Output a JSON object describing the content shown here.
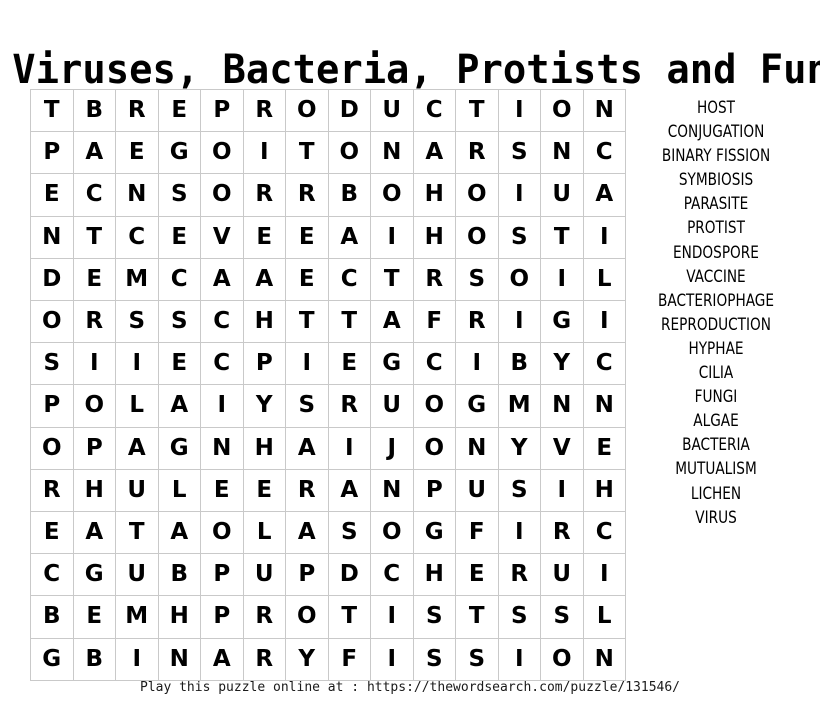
{
  "page": {
    "title": "Viruses, Bacteria, Protists and Fungi",
    "background_color": "#ffffff",
    "text_color": "#000000",
    "grid_border_color": "#c9c9c9"
  },
  "grid": {
    "rows": 14,
    "columns": 14,
    "letters": [
      [
        "T",
        "B",
        "R",
        "E",
        "P",
        "R",
        "O",
        "D",
        "U",
        "C",
        "T",
        "I",
        "O",
        "N"
      ],
      [
        "P",
        "A",
        "E",
        "G",
        "O",
        "I",
        "T",
        "O",
        "N",
        "A",
        "R",
        "S",
        "N",
        "C"
      ],
      [
        "E",
        "C",
        "N",
        "S",
        "O",
        "R",
        "R",
        "B",
        "O",
        "H",
        "O",
        "I",
        "U",
        "A"
      ],
      [
        "N",
        "T",
        "C",
        "E",
        "V",
        "E",
        "E",
        "A",
        "I",
        "H",
        "O",
        "S",
        "T",
        "I"
      ],
      [
        "D",
        "E",
        "M",
        "C",
        "A",
        "A",
        "E",
        "C",
        "T",
        "R",
        "S",
        "O",
        "I",
        "L"
      ],
      [
        "O",
        "R",
        "S",
        "S",
        "C",
        "H",
        "T",
        "T",
        "A",
        "F",
        "R",
        "I",
        "G",
        "I"
      ],
      [
        "S",
        "I",
        "I",
        "E",
        "C",
        "P",
        "I",
        "E",
        "G",
        "C",
        "I",
        "B",
        "Y",
        "C"
      ],
      [
        "P",
        "O",
        "L",
        "A",
        "I",
        "Y",
        "S",
        "R",
        "U",
        "O",
        "G",
        "M",
        "N",
        "N"
      ],
      [
        "O",
        "P",
        "A",
        "G",
        "N",
        "H",
        "A",
        "I",
        "J",
        "O",
        "N",
        "Y",
        "V",
        "E"
      ],
      [
        "R",
        "H",
        "U",
        "L",
        "E",
        "E",
        "R",
        "A",
        "N",
        "P",
        "U",
        "S",
        "I",
        "H"
      ],
      [
        "E",
        "A",
        "T",
        "A",
        "O",
        "L",
        "A",
        "S",
        "O",
        "G",
        "F",
        "I",
        "R",
        "C"
      ],
      [
        "C",
        "G",
        "U",
        "B",
        "P",
        "U",
        "P",
        "D",
        "C",
        "H",
        "E",
        "R",
        "U",
        "I"
      ],
      [
        "B",
        "E",
        "M",
        "H",
        "P",
        "R",
        "O",
        "T",
        "I",
        "S",
        "T",
        "S",
        "S",
        "L"
      ],
      [
        "G",
        "B",
        "I",
        "N",
        "A",
        "R",
        "Y",
        "F",
        "I",
        "S",
        "S",
        "I",
        "O",
        "N"
      ]
    ]
  },
  "word_list": {
    "words": [
      "HOST",
      "CONJUGATION",
      "BINARY FISSION",
      "SYMBIOSIS",
      "PARASITE",
      "PROTIST",
      "ENDOSPORE",
      "VACCINE",
      "BACTERIOPHAGE",
      "REPRODUCTION",
      "HYPHAE",
      "CILIA",
      "FUNGI",
      "ALGAE",
      "BACTERIA",
      "MUTUALISM",
      "LICHEN",
      "VIRUS"
    ]
  },
  "footer": {
    "text": "Play this puzzle online at : https://thewordsearch.com/puzzle/131546/"
  }
}
